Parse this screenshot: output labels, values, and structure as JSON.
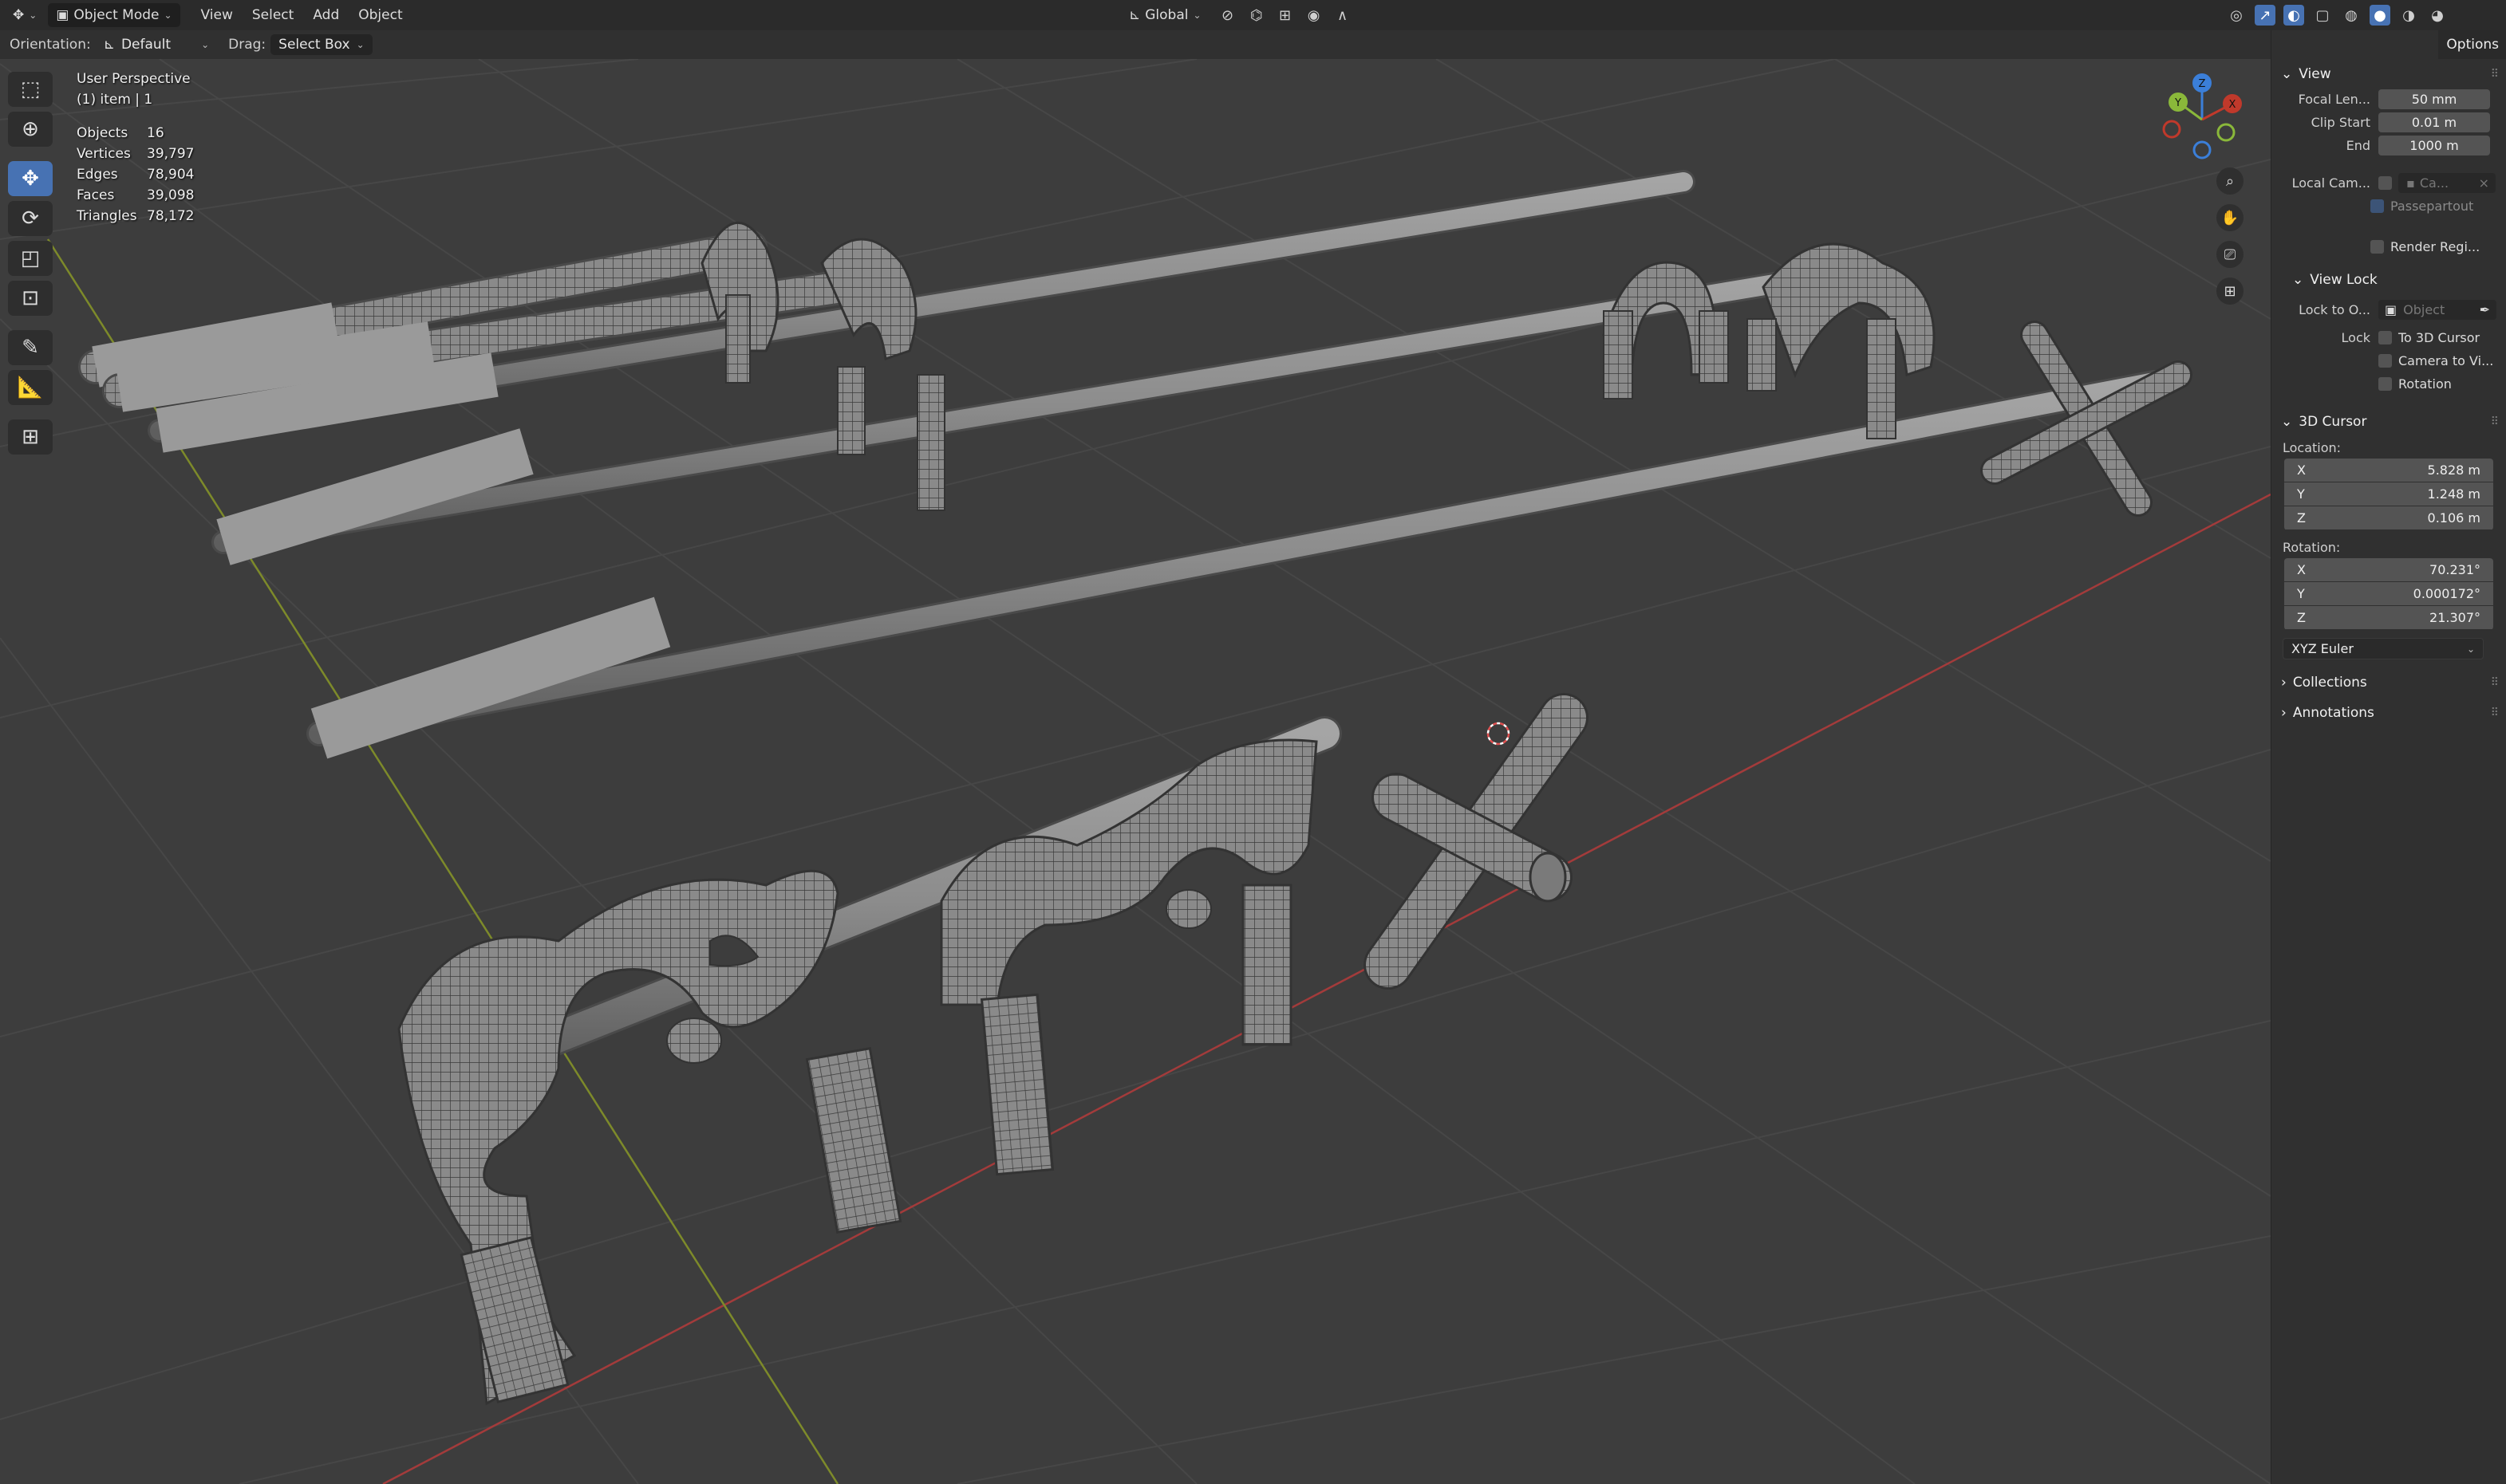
{
  "header": {
    "mode": "Object Mode",
    "menus": [
      "View",
      "Select",
      "Add",
      "Object"
    ],
    "transform_orientation": "Global"
  },
  "toolbar": {
    "orientation_label": "Orientation:",
    "orientation_value": "Default",
    "drag_label": "Drag:",
    "drag_value": "Select Box",
    "options_label": "Options"
  },
  "viewport": {
    "perspective": "User Perspective",
    "selection": "(1) item | 1",
    "stats": [
      {
        "label": "Objects",
        "value": "16"
      },
      {
        "label": "Vertices",
        "value": "39,797"
      },
      {
        "label": "Edges",
        "value": "78,904"
      },
      {
        "label": "Faces",
        "value": "39,098"
      },
      {
        "label": "Triangles",
        "value": "78,172"
      }
    ],
    "gizmo": {
      "x": "X",
      "y": "Y",
      "z": "Z"
    }
  },
  "panel": {
    "view": {
      "title": "View",
      "focal_label": "Focal Len...",
      "focal_value": "50 mm",
      "clip_start_label": "Clip Start",
      "clip_start_value": "0.01 m",
      "end_label": "End",
      "end_value": "1000 m",
      "local_cam_label": "Local Cam...",
      "local_cam_value": "Ca...",
      "passepartout": "Passepartout",
      "render_region": "Render Regi..."
    },
    "view_lock": {
      "title": "View Lock",
      "lock_to_label": "Lock to O...",
      "lock_to_placeholder": "Object",
      "lock_label": "Lock",
      "to_cursor": "To 3D Cursor",
      "camera_to_view": "Camera to Vi...",
      "rotation": "Rotation"
    },
    "cursor": {
      "title": "3D Cursor",
      "location_label": "Location:",
      "location": [
        {
          "axis": "X",
          "value": "5.828 m"
        },
        {
          "axis": "Y",
          "value": "1.248 m"
        },
        {
          "axis": "Z",
          "value": "0.106 m"
        }
      ],
      "rotation_label": "Rotation:",
      "rotation": [
        {
          "axis": "X",
          "value": "70.231°"
        },
        {
          "axis": "Y",
          "value": "0.000172°"
        },
        {
          "axis": "Z",
          "value": "21.307°"
        }
      ],
      "rotation_mode": "XYZ Euler"
    },
    "collections": "Collections",
    "annotations": "Annotations"
  },
  "colors": {
    "accent": "#4772b3",
    "x_axis": "#c0392b",
    "y_axis": "#8ab83a",
    "z_axis": "#3b7fd9"
  }
}
